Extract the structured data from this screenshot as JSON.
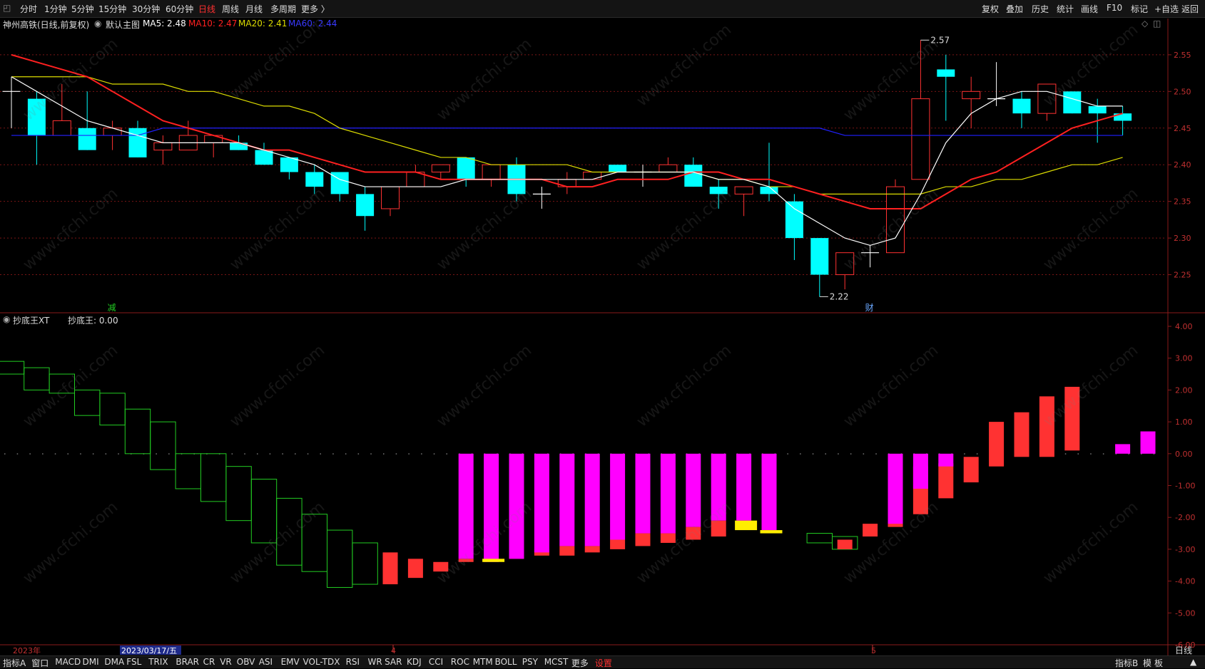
{
  "toolbar": {
    "periods": [
      "分时",
      "1分钟",
      "5分钟",
      "15分钟",
      "30分钟",
      "60分钟",
      "日线",
      "周线",
      "月线",
      "多周期",
      "更多 〉"
    ],
    "active_period": "日线",
    "right_items": [
      "复权",
      "叠加",
      "历史",
      "统计",
      "画线",
      "F10",
      "标记",
      "+自选",
      "返回"
    ]
  },
  "header": {
    "stock": "神州高铁(日线,前复权)",
    "main_label": "默认主图",
    "ma5": "MA5: 2.48",
    "ma10": "MA10: 2.47",
    "ma20": "MA20: 2.41",
    "ma60": "MA60: 2.44"
  },
  "sub_header": {
    "name": "抄底王XT",
    "value": "抄底王: 0.00"
  },
  "bottom": {
    "tabs": [
      "指标A",
      "窗口",
      "MACD",
      "DMI",
      "DMA",
      "FSL",
      "TRIX",
      "BRAR",
      "CR",
      "VR",
      "OBV",
      "ASI",
      "EMV",
      "VOL-TDX",
      "RSI",
      "WR",
      "SAR",
      "KDJ",
      "CCI",
      "ROC",
      "MTM",
      "BOLL",
      "PSY",
      "MCST",
      "更多",
      "设置"
    ],
    "right": [
      "指标B",
      "模",
      "板"
    ],
    "period_tag": "日线"
  },
  "colors": {
    "up": "#ff3232",
    "down": "#00ffff",
    "ma5": "#ffffff",
    "ma10": "#ff2020",
    "ma20": "#dddd00",
    "ma60": "#2020ff",
    "green_box": "#22cc22",
    "magenta": "#ff00ff",
    "yellow": "#ffee00",
    "grid": "#7a1515"
  },
  "chart_data": [
    {
      "type": "candlestick",
      "title": "神州高铁(日线,前复权)",
      "ylim": [
        2.2,
        2.58
      ],
      "yticks": [
        2.25,
        2.3,
        2.35,
        2.4,
        2.45,
        2.5,
        2.55
      ],
      "candles": [
        {
          "o": 2.5,
          "h": 2.52,
          "l": 2.45,
          "c": 2.5
        },
        {
          "o": 2.49,
          "h": 2.5,
          "l": 2.4,
          "c": 2.44
        },
        {
          "o": 2.44,
          "h": 2.51,
          "l": 2.44,
          "c": 2.46
        },
        {
          "o": 2.45,
          "h": 2.5,
          "l": 2.42,
          "c": 2.42
        },
        {
          "o": 2.44,
          "h": 2.46,
          "l": 2.42,
          "c": 2.45
        },
        {
          "o": 2.45,
          "h": 2.46,
          "l": 2.41,
          "c": 2.41
        },
        {
          "o": 2.42,
          "h": 2.44,
          "l": 2.4,
          "c": 2.43
        },
        {
          "o": 2.42,
          "h": 2.46,
          "l": 2.42,
          "c": 2.44
        },
        {
          "o": 2.43,
          "h": 2.44,
          "l": 2.41,
          "c": 2.44
        },
        {
          "o": 2.43,
          "h": 2.44,
          "l": 2.42,
          "c": 2.42
        },
        {
          "o": 2.42,
          "h": 2.43,
          "l": 2.4,
          "c": 2.4
        },
        {
          "o": 2.41,
          "h": 2.41,
          "l": 2.38,
          "c": 2.39
        },
        {
          "o": 2.39,
          "h": 2.4,
          "l": 2.36,
          "c": 2.37
        },
        {
          "o": 2.39,
          "h": 2.39,
          "l": 2.35,
          "c": 2.36
        },
        {
          "o": 2.36,
          "h": 2.37,
          "l": 2.31,
          "c": 2.33
        },
        {
          "o": 2.34,
          "h": 2.37,
          "l": 2.33,
          "c": 2.37
        },
        {
          "o": 2.37,
          "h": 2.4,
          "l": 2.37,
          "c": 2.39
        },
        {
          "o": 2.39,
          "h": 2.4,
          "l": 2.38,
          "c": 2.4
        },
        {
          "o": 2.41,
          "h": 2.41,
          "l": 2.37,
          "c": 2.38
        },
        {
          "o": 2.38,
          "h": 2.4,
          "l": 2.37,
          "c": 2.4
        },
        {
          "o": 2.4,
          "h": 2.41,
          "l": 2.35,
          "c": 2.36
        },
        {
          "o": 2.36,
          "h": 2.37,
          "l": 2.34,
          "c": 2.36
        },
        {
          "o": 2.37,
          "h": 2.39,
          "l": 2.36,
          "c": 2.38
        },
        {
          "o": 2.38,
          "h": 2.39,
          "l": 2.38,
          "c": 2.39
        },
        {
          "o": 2.4,
          "h": 2.4,
          "l": 2.39,
          "c": 2.39
        },
        {
          "o": 2.39,
          "h": 2.4,
          "l": 2.37,
          "c": 2.39
        },
        {
          "o": 2.39,
          "h": 2.41,
          "l": 2.39,
          "c": 2.4
        },
        {
          "o": 2.4,
          "h": 2.41,
          "l": 2.37,
          "c": 2.37
        },
        {
          "o": 2.37,
          "h": 2.38,
          "l": 2.34,
          "c": 2.36
        },
        {
          "o": 2.36,
          "h": 2.37,
          "l": 2.33,
          "c": 2.37
        },
        {
          "o": 2.37,
          "h": 2.43,
          "l": 2.35,
          "c": 2.36
        },
        {
          "o": 2.35,
          "h": 2.36,
          "l": 2.27,
          "c": 2.3
        },
        {
          "o": 2.3,
          "h": 2.3,
          "l": 2.22,
          "c": 2.25
        },
        {
          "o": 2.25,
          "h": 2.28,
          "l": 2.23,
          "c": 2.28
        },
        {
          "o": 2.28,
          "h": 2.29,
          "l": 2.26,
          "c": 2.28
        },
        {
          "o": 2.28,
          "h": 2.38,
          "l": 2.28,
          "c": 2.37
        },
        {
          "o": 2.38,
          "h": 2.57,
          "l": 2.38,
          "c": 2.49
        },
        {
          "o": 2.53,
          "h": 2.55,
          "l": 2.46,
          "c": 2.52
        },
        {
          "o": 2.49,
          "h": 2.52,
          "l": 2.45,
          "c": 2.5
        },
        {
          "o": 2.49,
          "h": 2.54,
          "l": 2.48,
          "c": 2.49
        },
        {
          "o": 2.49,
          "h": 2.5,
          "l": 2.45,
          "c": 2.47
        },
        {
          "o": 2.47,
          "h": 2.51,
          "l": 2.46,
          "c": 2.51
        },
        {
          "o": 2.5,
          "h": 2.5,
          "l": 2.47,
          "c": 2.47
        },
        {
          "o": 2.48,
          "h": 2.49,
          "l": 2.43,
          "c": 2.47
        },
        {
          "o": 2.47,
          "h": 2.48,
          "l": 2.44,
          "c": 2.46
        }
      ],
      "ma5": [
        2.52,
        2.5,
        2.48,
        2.46,
        2.45,
        2.44,
        2.43,
        2.43,
        2.43,
        2.43,
        2.42,
        2.41,
        2.4,
        2.38,
        2.37,
        2.37,
        2.37,
        2.37,
        2.38,
        2.38,
        2.38,
        2.38,
        2.38,
        2.38,
        2.39,
        2.39,
        2.39,
        2.39,
        2.38,
        2.38,
        2.37,
        2.34,
        2.32,
        2.3,
        2.29,
        2.3,
        2.36,
        2.43,
        2.47,
        2.49,
        2.5,
        2.5,
        2.49,
        2.48,
        2.48
      ],
      "ma10": [
        2.55,
        2.54,
        2.53,
        2.52,
        2.5,
        2.48,
        2.46,
        2.45,
        2.44,
        2.43,
        2.42,
        2.42,
        2.41,
        2.4,
        2.39,
        2.39,
        2.39,
        2.38,
        2.38,
        2.38,
        2.38,
        2.38,
        2.37,
        2.37,
        2.38,
        2.38,
        2.38,
        2.39,
        2.39,
        2.38,
        2.38,
        2.37,
        2.36,
        2.35,
        2.34,
        2.34,
        2.34,
        2.36,
        2.38,
        2.39,
        2.41,
        2.43,
        2.45,
        2.46,
        2.47
      ],
      "ma20": [
        2.52,
        2.52,
        2.52,
        2.52,
        2.51,
        2.51,
        2.51,
        2.5,
        2.5,
        2.49,
        2.48,
        2.48,
        2.47,
        2.45,
        2.44,
        2.43,
        2.42,
        2.41,
        2.41,
        2.4,
        2.4,
        2.4,
        2.4,
        2.39,
        2.39,
        2.39,
        2.39,
        2.39,
        2.38,
        2.38,
        2.37,
        2.37,
        2.36,
        2.36,
        2.36,
        2.36,
        2.36,
        2.37,
        2.37,
        2.38,
        2.38,
        2.39,
        2.4,
        2.4,
        2.41
      ],
      "ma60": [
        2.44,
        2.44,
        2.44,
        2.44,
        2.44,
        2.44,
        2.45,
        2.45,
        2.45,
        2.45,
        2.45,
        2.45,
        2.45,
        2.45,
        2.45,
        2.45,
        2.45,
        2.45,
        2.45,
        2.45,
        2.45,
        2.45,
        2.45,
        2.45,
        2.45,
        2.45,
        2.45,
        2.45,
        2.45,
        2.45,
        2.45,
        2.45,
        2.45,
        2.44,
        2.44,
        2.44,
        2.44,
        2.44,
        2.44,
        2.44,
        2.44,
        2.44,
        2.44,
        2.44,
        2.44
      ],
      "annotations": [
        {
          "label": "2.57",
          "index": 36,
          "value": 2.57
        },
        {
          "label": "2.22",
          "index": 32,
          "value": 2.22
        }
      ],
      "markers": [
        {
          "text": "减",
          "index": 4
        },
        {
          "text": "财",
          "index": 34
        }
      ]
    },
    {
      "type": "bar",
      "title": "抄底王XT",
      "ylim": [
        -6.0,
        4.0
      ],
      "yticks": [
        4.0,
        3.0,
        2.0,
        1.0,
        0.0,
        -1.0,
        -2.0,
        -3.0,
        -4.0,
        -5.0,
        -6.0
      ],
      "green_steps": [
        {
          "top": 2.9,
          "bottom": 2.5
        },
        {
          "top": 2.7,
          "bottom": 2.0
        },
        {
          "top": 2.5,
          "bottom": 1.9
        },
        {
          "top": 2.0,
          "bottom": 1.2
        },
        {
          "top": 1.9,
          "bottom": 0.9
        },
        {
          "top": 1.4,
          "bottom": 0.0
        },
        {
          "top": 1.0,
          "bottom": -0.5
        },
        {
          "top": 0.0,
          "bottom": -1.1
        },
        {
          "top": 0.0,
          "bottom": -1.5
        },
        {
          "top": -0.4,
          "bottom": -2.1
        },
        {
          "top": -0.8,
          "bottom": -2.8
        },
        {
          "top": -1.4,
          "bottom": -3.5
        },
        {
          "top": -1.9,
          "bottom": -3.7
        },
        {
          "top": -2.4,
          "bottom": -4.2
        },
        {
          "top": -2.8,
          "bottom": -4.1
        },
        null,
        null,
        null,
        null,
        null,
        null,
        null,
        null,
        null,
        null,
        null,
        null,
        null,
        null,
        null,
        null,
        null,
        {
          "top": -2.5,
          "bottom": -2.8
        },
        {
          "top": -2.6,
          "bottom": -3.0
        },
        null,
        null,
        null,
        null,
        null,
        null,
        null,
        null,
        null,
        null,
        null,
        null
      ],
      "red": [
        null,
        null,
        null,
        null,
        null,
        null,
        null,
        null,
        null,
        null,
        null,
        null,
        null,
        null,
        null,
        [
          -3.1,
          -4.1
        ],
        [
          -3.3,
          -3.9
        ],
        [
          -3.4,
          -3.7
        ],
        [
          -3.3,
          -3.4
        ],
        null,
        [
          -3.1,
          -3.3
        ],
        [
          -3.0,
          -3.2
        ],
        [
          -2.9,
          -3.2
        ],
        [
          -2.9,
          -3.1
        ],
        [
          -2.7,
          -3.0
        ],
        [
          -2.5,
          -2.9
        ],
        [
          -2.5,
          -2.8
        ],
        [
          -2.3,
          -2.7
        ],
        [
          -2.1,
          -2.6
        ],
        null,
        null,
        null,
        null,
        [
          -2.7,
          -3.0
        ],
        [
          -2.2,
          -2.6
        ],
        [
          -1.1,
          -2.3
        ],
        [
          -0.4,
          -1.9
        ],
        [
          -0.3,
          -1.4
        ],
        [
          -0.1,
          -0.9
        ],
        [
          1.0,
          -0.4
        ],
        [
          1.3,
          -0.1
        ],
        [
          1.8,
          -0.1
        ],
        [
          2.1,
          0.1
        ]
      ],
      "magenta": [
        null,
        null,
        null,
        null,
        null,
        null,
        null,
        null,
        null,
        null,
        null,
        null,
        null,
        null,
        null,
        null,
        null,
        null,
        [
          0.0,
          -3.3
        ],
        [
          0.0,
          -3.4
        ],
        [
          0.0,
          -3.3
        ],
        [
          0.0,
          -3.1
        ],
        [
          0.0,
          -2.9
        ],
        [
          0.0,
          -2.9
        ],
        [
          0.0,
          -2.7
        ],
        [
          0.0,
          -2.5
        ],
        [
          0.0,
          -2.5
        ],
        [
          0.0,
          -2.3
        ],
        [
          0.0,
          -2.1
        ],
        [
          0.0,
          -2.1
        ],
        [
          0.0,
          -2.4
        ],
        null,
        null,
        null,
        null,
        [
          0.0,
          -2.2
        ],
        [
          0.0,
          -1.1
        ],
        [
          0.0,
          -0.4
        ],
        null,
        null,
        null,
        null,
        null,
        null,
        [
          0.3,
          0.0
        ],
        [
          0.7,
          0.0
        ]
      ],
      "yellow": [
        null,
        null,
        null,
        null,
        null,
        null,
        null,
        null,
        null,
        null,
        null,
        null,
        null,
        null,
        null,
        null,
        null,
        null,
        null,
        [
          -3.3,
          -3.4
        ],
        null,
        null,
        null,
        null,
        null,
        null,
        null,
        null,
        null,
        [
          -2.1,
          -2.4
        ],
        [
          -2.4,
          -2.5
        ],
        null,
        null,
        null,
        null,
        null,
        null,
        null,
        null,
        null,
        null,
        null,
        null,
        null,
        null
      ],
      "dots_at_zero": true
    }
  ],
  "axis_dates": [
    "2023年",
    "2023/03/17/五",
    "4",
    "5"
  ]
}
